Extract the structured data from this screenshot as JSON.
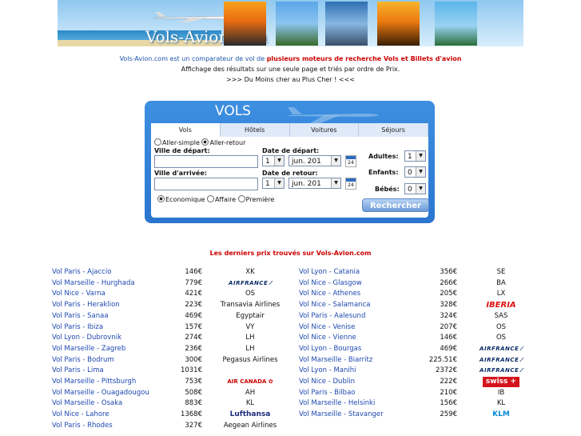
{
  "header": {
    "logo": "Vols-Avion.com"
  },
  "intro": {
    "line1_plain": "Vols-Avion.com est un comparateur de vol de ",
    "line1_red": "plusieurs moteurs de recherche Vols et Billets d'avion",
    "line2": "Affichage des résultats sur une seule page et triés par ordre de Prix.",
    "line3": ">>> Du Moins cher au Plus Cher ! <<<"
  },
  "widget": {
    "title": "VOLS",
    "tabs": [
      "Vols",
      "Hôtels",
      "Voitures",
      "Séjours"
    ],
    "trip_types": [
      "Aller-simple",
      "Aller-retour"
    ],
    "depart_city_label": "Ville de départ:",
    "arrival_city_label": "Ville d'arrivée:",
    "depart_date_label": "Date de départ:",
    "return_date_label": "Date de retour:",
    "depart_day": "1",
    "depart_month": "jun. 201",
    "return_day": "1",
    "return_month": "jun. 201",
    "calendar_label": "24",
    "classes": [
      "Economique",
      "Affaire",
      "Première"
    ],
    "adults_label": "Adultes:",
    "children_label": "Enfants:",
    "babies_label": "Bébés:",
    "adults": "1",
    "children": "0",
    "babies": "0",
    "search_button": "Rechercher"
  },
  "prices_title": "Les derniers prix trouvés sur Vols-Avion.com",
  "left_prices": [
    {
      "route": "Vol Paris - Ajaccio",
      "price": "146€",
      "airline": "XK"
    },
    {
      "route": "Vol Marseille - Hurghada",
      "price": "779€",
      "airline": "AIRFRANCE",
      "logo": "af"
    },
    {
      "route": "Vol Nice - Varna",
      "price": "421€",
      "airline": "OS"
    },
    {
      "route": "Vol Paris - Heraklion",
      "price": "223€",
      "airline": "Transavia Airlines"
    },
    {
      "route": "Vol Paris - Sanaa",
      "price": "469€",
      "airline": "Egyptair"
    },
    {
      "route": "Vol Paris - Ibiza",
      "price": "157€",
      "airline": "VY"
    },
    {
      "route": "Vol Lyon - Dubrovnik",
      "price": "274€",
      "airline": "LH"
    },
    {
      "route": "Vol Marseille - Zagreb",
      "price": "236€",
      "airline": "LH"
    },
    {
      "route": "Vol Paris - Bodrum",
      "price": "300€",
      "airline": "Pegasus Airlines"
    },
    {
      "route": "Vol Paris - Lima",
      "price": "1031€",
      "airline": ""
    },
    {
      "route": "Vol Marseille - Pittsburgh",
      "price": "753€",
      "airline": "AIR CANADA",
      "logo": "ac"
    },
    {
      "route": "Vol Marseille - Ouagadougou",
      "price": "508€",
      "airline": "AH"
    },
    {
      "route": "Vol Marseille - Osaka",
      "price": "883€",
      "airline": "KL"
    },
    {
      "route": "Vol Nice - Lahore",
      "price": "1368€",
      "airline": "Lufthansa",
      "logo": "lh"
    },
    {
      "route": "Vol Paris - Rhodes",
      "price": "327€",
      "airline": "Aegean Airlines"
    }
  ],
  "right_prices": [
    {
      "route": "Vol Lyon - Catania",
      "price": "356€",
      "airline": "SE"
    },
    {
      "route": "Vol Nice - Glasgow",
      "price": "266€",
      "airline": "BA"
    },
    {
      "route": "Vol Nice - Athenes",
      "price": "205€",
      "airline": "LX"
    },
    {
      "route": "Vol Nice - Salamanca",
      "price": "328€",
      "airline": "IBERIA",
      "logo": "ib"
    },
    {
      "route": "Vol Paris - Aalesund",
      "price": "324€",
      "airline": "SAS"
    },
    {
      "route": "Vol Nice - Venise",
      "price": "207€",
      "airline": "OS"
    },
    {
      "route": "Vol Nice - Vienne",
      "price": "146€",
      "airline": "OS"
    },
    {
      "route": "Vol Lyon - Bourgas",
      "price": "469€",
      "airline": "AIRFRANCE",
      "logo": "af"
    },
    {
      "route": "Vol Marseille - Biarritz",
      "price": "225.51€",
      "airline": "AIRFRANCE",
      "logo": "af"
    },
    {
      "route": "Vol Lyon - Manihi",
      "price": "2372€",
      "airline": "AIRFRANCE",
      "logo": "af"
    },
    {
      "route": "Vol Nice - Dublin",
      "price": "222€",
      "airline": "swiss",
      "logo": "sw"
    },
    {
      "route": "Vol Paris - Bilbao",
      "price": "210€",
      "airline": "IB"
    },
    {
      "route": "Vol Marseille - Helsinki",
      "price": "156€",
      "airline": "KL"
    },
    {
      "route": "Vol Marseille - Stavanger",
      "price": "259€",
      "airline": "KLM",
      "logo": "klm"
    }
  ]
}
